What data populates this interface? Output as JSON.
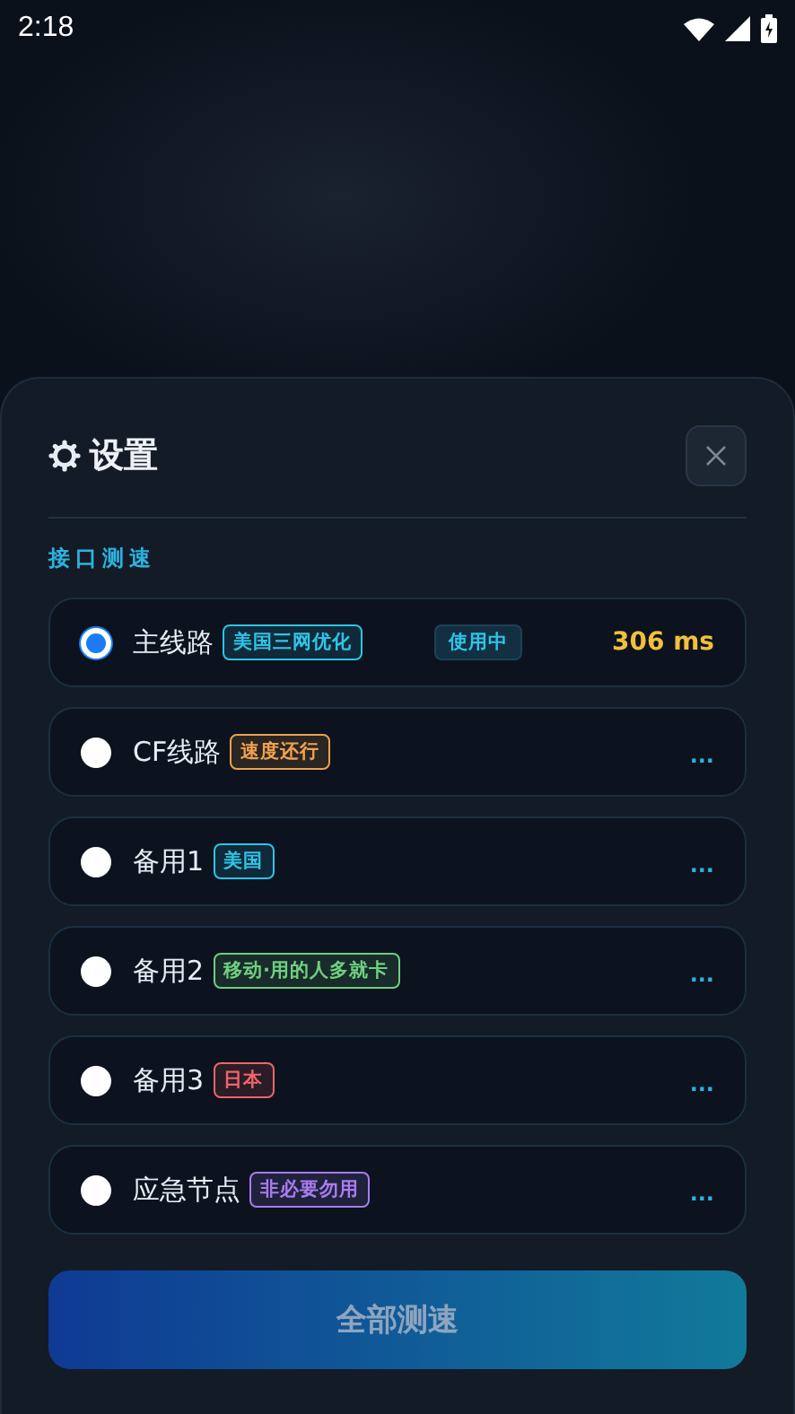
{
  "status_bar": {
    "time": "2:18"
  },
  "sheet": {
    "title": "设置",
    "section": "接口测速",
    "routes": [
      {
        "name": "主线路",
        "tag": "美国三网优化",
        "color": "#2ec4e8",
        "selected": true,
        "badge": "使用中",
        "latency": "306 ms"
      },
      {
        "name": "CF线路",
        "tag": "速度还行",
        "color": "#f0a24a",
        "selected": false,
        "more": "..."
      },
      {
        "name": "备用1",
        "tag": "美国",
        "color": "#2ec4e8",
        "selected": false,
        "more": "..."
      },
      {
        "name": "备用2",
        "tag": "移动·用的人多就卡",
        "color": "#6fcf7f",
        "selected": false,
        "more": "..."
      },
      {
        "name": "备用3",
        "tag": "日本",
        "color": "#f0646a",
        "selected": false,
        "more": "..."
      },
      {
        "name": "应急节点",
        "tag": "非必要勿用",
        "color": "#a77cf0",
        "selected": false,
        "more": "..."
      }
    ],
    "button": "全部测速"
  }
}
